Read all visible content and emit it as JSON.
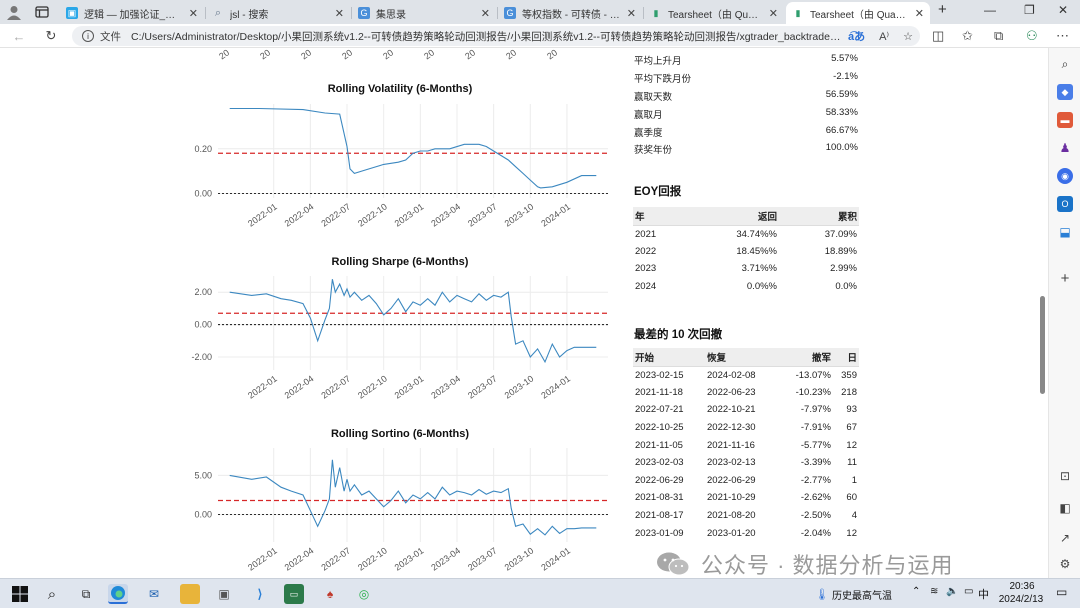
{
  "browser": {
    "tabs": [
      {
        "title": "逻辑 — 加强论证_哔哩哔哩",
        "active": false,
        "color": "#2aa7e8"
      },
      {
        "title": "jsl - 搜索",
        "active": false,
        "color": "#7a8ba0"
      },
      {
        "title": "集思录",
        "active": false,
        "color": "#4a8fd9"
      },
      {
        "title": "等权指数 - 可转债 - 集思录",
        "active": false,
        "color": "#4a8fd9"
      },
      {
        "title": "Tearsheet（由 QuantStats",
        "active": false,
        "color": "#2f9e6e"
      },
      {
        "title": "Tearsheet（由 QuantStats",
        "active": true,
        "color": "#2f9e6e"
      }
    ],
    "address_label": "文件",
    "url": "C:/Users/Administrator/Desktop/小果回测系统v1.2--可转债趋势策略轮动回测报告/小果回测系统v1.2--可转债趋势策略轮动回测报告/xgtrader_backtrader/交易..."
  },
  "charts": {
    "volatility": {
      "title": "Rolling Volatility (6-Months)"
    },
    "sharpe": {
      "title": "Rolling Sharpe (6-Months)"
    },
    "sortino": {
      "title": "Rolling Sortino (6-Months)"
    }
  },
  "chart_data": [
    {
      "type": "line",
      "title": "Rolling Volatility (6-Months)",
      "x_ticks": [
        "2022-01",
        "2022-04",
        "2022-07",
        "2022-10",
        "2023-01",
        "2023-04",
        "2023-07",
        "2023-10",
        "2024-01"
      ],
      "y_ticks": [
        "0.00",
        "0.20"
      ],
      "ylim": [
        -0.02,
        0.4
      ],
      "mean_line": 0.18,
      "zero_line": 0.0,
      "colors": {
        "line": "#3c88c0",
        "mean": "#d62728",
        "zero": "#111111"
      },
      "series": [
        {
          "x": [
            2021.7,
            2021.9,
            2022.2,
            2022.35,
            2022.45,
            2022.5,
            2022.52,
            2022.55,
            2022.6,
            2022.65,
            2022.75,
            2022.8,
            2022.85,
            2022.9,
            2022.95,
            2023.0,
            2023.05,
            2023.1,
            2023.15,
            2023.2,
            2023.3,
            2023.4,
            2023.45,
            2023.5,
            2023.55,
            2023.6,
            2023.65,
            2023.7,
            2023.75,
            2023.8,
            2023.82,
            2023.9,
            2024.0,
            2024.1,
            2024.2
          ],
          "y": [
            0.38,
            0.38,
            0.375,
            0.36,
            0.355,
            0.21,
            0.11,
            0.09,
            0.1,
            0.11,
            0.13,
            0.135,
            0.14,
            0.15,
            0.18,
            0.19,
            0.19,
            0.2,
            0.2,
            0.2,
            0.22,
            0.22,
            0.21,
            0.19,
            0.17,
            0.15,
            0.12,
            0.09,
            0.06,
            0.03,
            0.025,
            0.03,
            0.05,
            0.08,
            0.08
          ]
        }
      ]
    },
    {
      "type": "line",
      "title": "Rolling Sharpe (6-Months)",
      "x_ticks": [
        "2022-01",
        "2022-04",
        "2022-07",
        "2022-10",
        "2023-01",
        "2023-04",
        "2023-07",
        "2023-10",
        "2024-01"
      ],
      "y_ticks": [
        "2.00",
        "0.00",
        "-2.00"
      ],
      "ylim": [
        -2.8,
        3.0
      ],
      "mean_line": 0.7,
      "zero_line": 0.0,
      "colors": {
        "line": "#3c88c0",
        "mean": "#d62728",
        "zero": "#111111"
      },
      "series": [
        {
          "x": [
            2021.7,
            2021.85,
            2021.95,
            2022.05,
            2022.12,
            2022.2,
            2022.25,
            2022.3,
            2022.35,
            2022.38,
            2022.4,
            2022.42,
            2022.45,
            2022.48,
            2022.5,
            2022.52,
            2022.55,
            2022.6,
            2022.65,
            2022.7,
            2022.75,
            2022.8,
            2022.85,
            2022.9,
            2022.95,
            2023.0,
            2023.05,
            2023.1,
            2023.15,
            2023.2,
            2023.25,
            2023.3,
            2023.35,
            2023.4,
            2023.45,
            2023.5,
            2023.55,
            2023.6,
            2023.62,
            2023.65,
            2023.7,
            2023.75,
            2023.8,
            2023.85,
            2023.9,
            2023.95,
            2024.0,
            2024.05,
            2024.1,
            2024.2
          ],
          "y": [
            2.0,
            1.8,
            1.9,
            1.6,
            1.5,
            1.3,
            0.4,
            -1.0,
            0.3,
            1.0,
            2.8,
            2.0,
            2.5,
            1.8,
            2.2,
            1.7,
            2.0,
            1.5,
            1.8,
            1.3,
            0.6,
            1.0,
            1.6,
            0.8,
            1.4,
            1.2,
            1.6,
            1.2,
            2.0,
            1.4,
            1.8,
            1.6,
            1.4,
            1.9,
            1.5,
            1.8,
            1.7,
            2.0,
            0.5,
            -1.2,
            -1.0,
            -2.0,
            -1.5,
            -2.3,
            -1.2,
            -2.0,
            -1.6,
            -1.4,
            -1.4,
            -1.4
          ]
        }
      ]
    },
    {
      "type": "line",
      "title": "Rolling Sortino (6-Months)",
      "x_ticks": [
        "2022-01",
        "2022-04",
        "2022-07",
        "2022-10",
        "2023-01",
        "2023-04",
        "2023-07",
        "2023-10",
        "2024-01"
      ],
      "y_ticks": [
        "5.00",
        "0.00"
      ],
      "ylim": [
        -3.5,
        8.5
      ],
      "mean_line": 1.8,
      "zero_line": 0.0,
      "colors": {
        "line": "#3c88c0",
        "mean": "#d62728",
        "zero": "#111111"
      },
      "series": [
        {
          "x": [
            2021.7,
            2021.85,
            2021.95,
            2022.05,
            2022.12,
            2022.2,
            2022.25,
            2022.3,
            2022.35,
            2022.38,
            2022.4,
            2022.42,
            2022.45,
            2022.48,
            2022.5,
            2022.52,
            2022.55,
            2022.6,
            2022.65,
            2022.7,
            2022.75,
            2022.8,
            2022.85,
            2022.9,
            2022.95,
            2023.0,
            2023.05,
            2023.1,
            2023.15,
            2023.2,
            2023.25,
            2023.3,
            2023.35,
            2023.4,
            2023.45,
            2023.5,
            2023.55,
            2023.6,
            2023.62,
            2023.65,
            2023.7,
            2023.75,
            2023.8,
            2023.85,
            2023.9,
            2023.95,
            2024.0,
            2024.05,
            2024.1,
            2024.2
          ],
          "y": [
            5.0,
            4.5,
            4.8,
            3.5,
            3.0,
            2.5,
            0.5,
            -1.5,
            0.5,
            2.0,
            7.0,
            3.5,
            6.0,
            3.0,
            4.5,
            3.0,
            3.8,
            2.5,
            3.0,
            2.0,
            1.0,
            1.8,
            3.0,
            1.5,
            2.5,
            2.0,
            2.8,
            2.0,
            3.5,
            2.5,
            3.0,
            2.8,
            2.5,
            3.2,
            2.6,
            3.0,
            2.8,
            3.3,
            0.8,
            -1.5,
            -1.2,
            -2.5,
            -1.8,
            -2.6,
            -1.5,
            -2.4,
            -1.8,
            -1.8,
            -1.7,
            -1.7
          ]
        }
      ]
    }
  ],
  "metrics": [
    {
      "label": "平均上升月",
      "value": "5.57%"
    },
    {
      "label": "平均下跌月份",
      "value": "-2.1%"
    },
    {
      "label": "赢取天数",
      "value": "56.59%"
    },
    {
      "label": "赢取月",
      "value": "58.33%"
    },
    {
      "label": "赢季度",
      "value": "66.67%"
    },
    {
      "label": "获奖年份",
      "value": "100.0%"
    }
  ],
  "eoy": {
    "title": "EOY回报",
    "headers": [
      "年",
      "返回",
      "累积"
    ],
    "rows": [
      [
        "2021",
        "34.74%%",
        "37.09%"
      ],
      [
        "2022",
        "18.45%%",
        "18.89%"
      ],
      [
        "2023",
        "3.71%%",
        "2.99%"
      ],
      [
        "2024",
        "0.0%%",
        "0.0%"
      ]
    ]
  },
  "drawdowns": {
    "title": "最差的 10 次回撤",
    "headers": [
      "开始",
      "恢复",
      "撤军",
      "日"
    ],
    "rows": [
      [
        "2023-02-15",
        "2024-02-08",
        "-13.07%",
        "359"
      ],
      [
        "2021-11-18",
        "2022-06-23",
        "-10.23%",
        "218"
      ],
      [
        "2022-07-21",
        "2022-10-21",
        "-7.97%",
        "93"
      ],
      [
        "2022-10-25",
        "2022-12-30",
        "-7.91%",
        "67"
      ],
      [
        "2021-11-05",
        "2021-11-16",
        "-5.77%",
        "12"
      ],
      [
        "2023-02-03",
        "2023-02-13",
        "-3.39%",
        "11"
      ],
      [
        "2022-06-29",
        "2022-06-29",
        "-2.77%",
        "1"
      ],
      [
        "2021-08-31",
        "2021-10-29",
        "-2.62%",
        "60"
      ],
      [
        "2021-08-17",
        "2021-08-20",
        "-2.50%",
        "4"
      ],
      [
        "2023-01-09",
        "2023-01-20",
        "-2.04%",
        "12"
      ]
    ]
  },
  "watermark": {
    "text": "公众号 · 数据分析与运用"
  },
  "taskbar": {
    "weather": "历史最高气温",
    "ime": "中",
    "time": "20:36",
    "date": "2024/2/13"
  }
}
